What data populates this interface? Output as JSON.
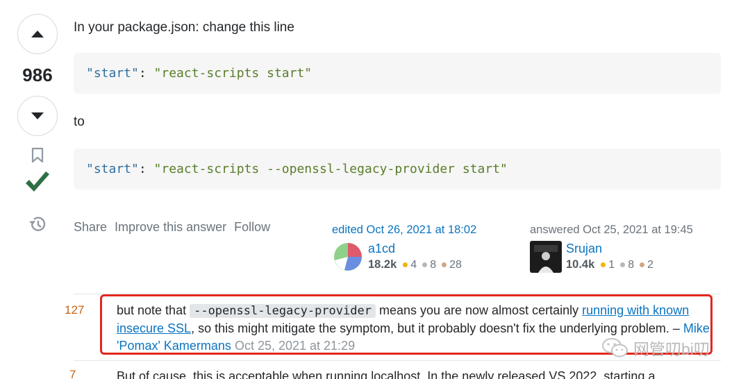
{
  "vote": {
    "count": "986"
  },
  "post": {
    "intro": "In your package.json: change this line",
    "code1": {
      "key": "\"start\"",
      "colon": ": ",
      "value": "\"react-scripts start\""
    },
    "to": "to",
    "code2": {
      "key": "\"start\"",
      "colon": ": ",
      "value": "\"react-scripts --openssl-legacy-provider start\""
    }
  },
  "menu": {
    "share": "Share",
    "improve": "Improve this answer",
    "follow": "Follow"
  },
  "editor": {
    "action": "edited Oct 26, 2021 at 18:02",
    "name": "a1cd",
    "rep": "18.2k",
    "gold": "4",
    "silver": "8",
    "bronze": "28"
  },
  "answerer": {
    "action": "answered Oct 25, 2021 at 19:45",
    "name": "Srujan",
    "rep": "10.4k",
    "gold": "1",
    "silver": "8",
    "bronze": "2"
  },
  "comments": [
    {
      "score": "127",
      "text_before": "but note that ",
      "code": "--openssl-legacy-provider",
      "text_mid": " means you are now almost certainly ",
      "link": "running with known insecure SSL",
      "text_after": ", so this might mitigate the symptom, but it probably doesn't fix the underlying problem. – ",
      "author": "Mike 'Pomax' Kamermans",
      "date": "Oct 25, 2021 at 21:29"
    },
    {
      "score": "7",
      "text": "But of cause, this is acceptable when running localhost. In the newly released VS 2022, starting a"
    }
  ],
  "watermark": {
    "text": "网管叨bi叨"
  },
  "colors": {
    "accent": "#0a74c0",
    "accept": "#2f6f44",
    "highlight": "#e2271d",
    "gold": "#f1b600",
    "silver": "#b4b8bc",
    "bronze": "#d1a684"
  },
  "icons": [
    "upvote-icon",
    "downvote-icon",
    "bookmark-icon",
    "accepted-check-icon",
    "history-icon",
    "wechat-icon"
  ]
}
